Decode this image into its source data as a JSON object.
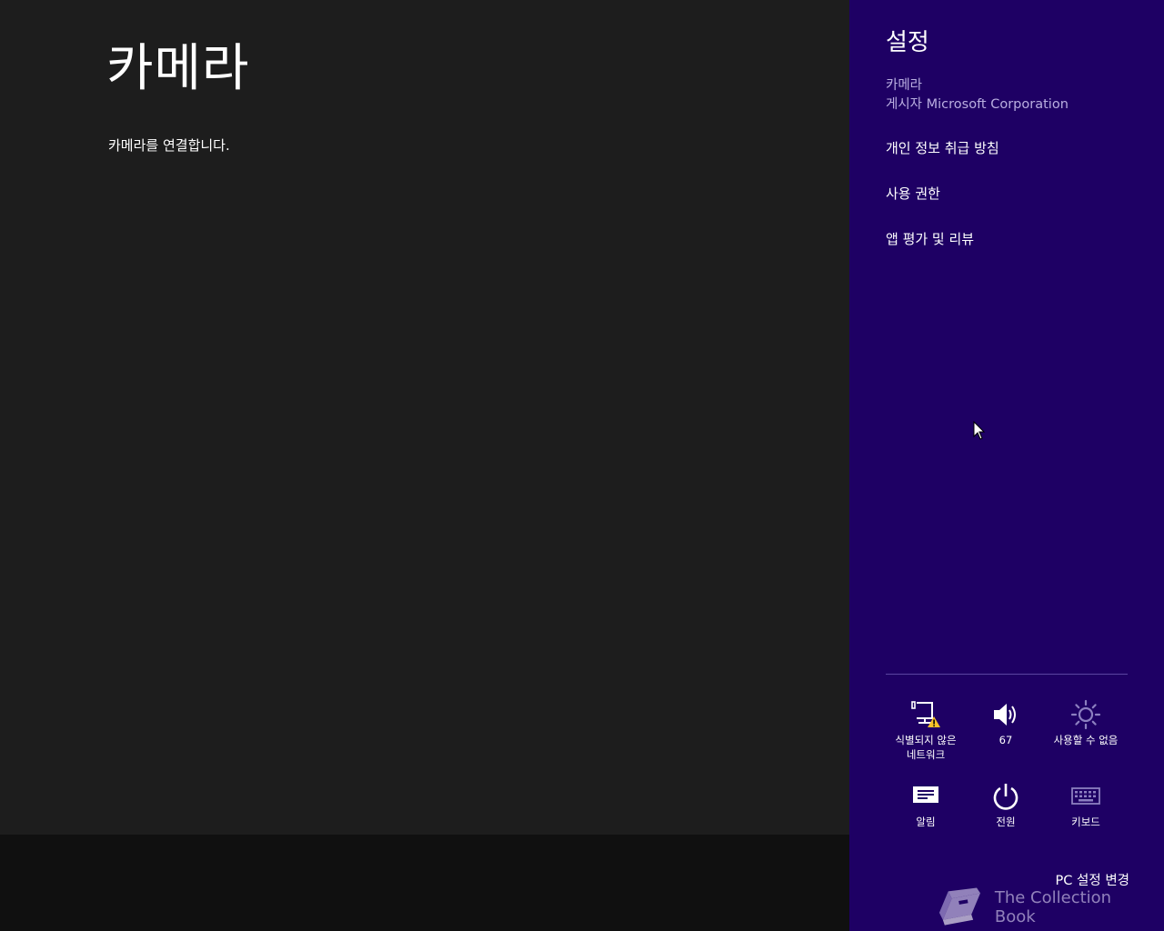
{
  "app": {
    "title": "카메라",
    "message": "카메라를 연결합니다."
  },
  "charm": {
    "title": "설정",
    "app_name": "카메라",
    "publisher": "게시자 Microsoft Corporation",
    "menu": [
      {
        "label": "개인 정보 취급 방침"
      },
      {
        "label": "사용 권한"
      },
      {
        "label": "앱 평가 및 리뷰"
      }
    ],
    "quick_settings": [
      {
        "icon": "network-warning-icon",
        "label": "식별되지 않은\n네트워크"
      },
      {
        "icon": "volume-icon",
        "label": "67"
      },
      {
        "icon": "brightness-icon",
        "label": "사용할 수 없음"
      },
      {
        "icon": "notifications-icon",
        "label": "알림"
      },
      {
        "icon": "power-icon",
        "label": "전원"
      },
      {
        "icon": "keyboard-icon",
        "label": "키보드"
      }
    ],
    "pc_settings_label": "PC 설정 변경"
  },
  "watermark": {
    "text": "The Collection Book"
  },
  "colors": {
    "app_background": "#1d1d1d",
    "app_bottom_bar": "#101010",
    "charm_background": "#1e0064",
    "warning": "#f7c12a"
  }
}
